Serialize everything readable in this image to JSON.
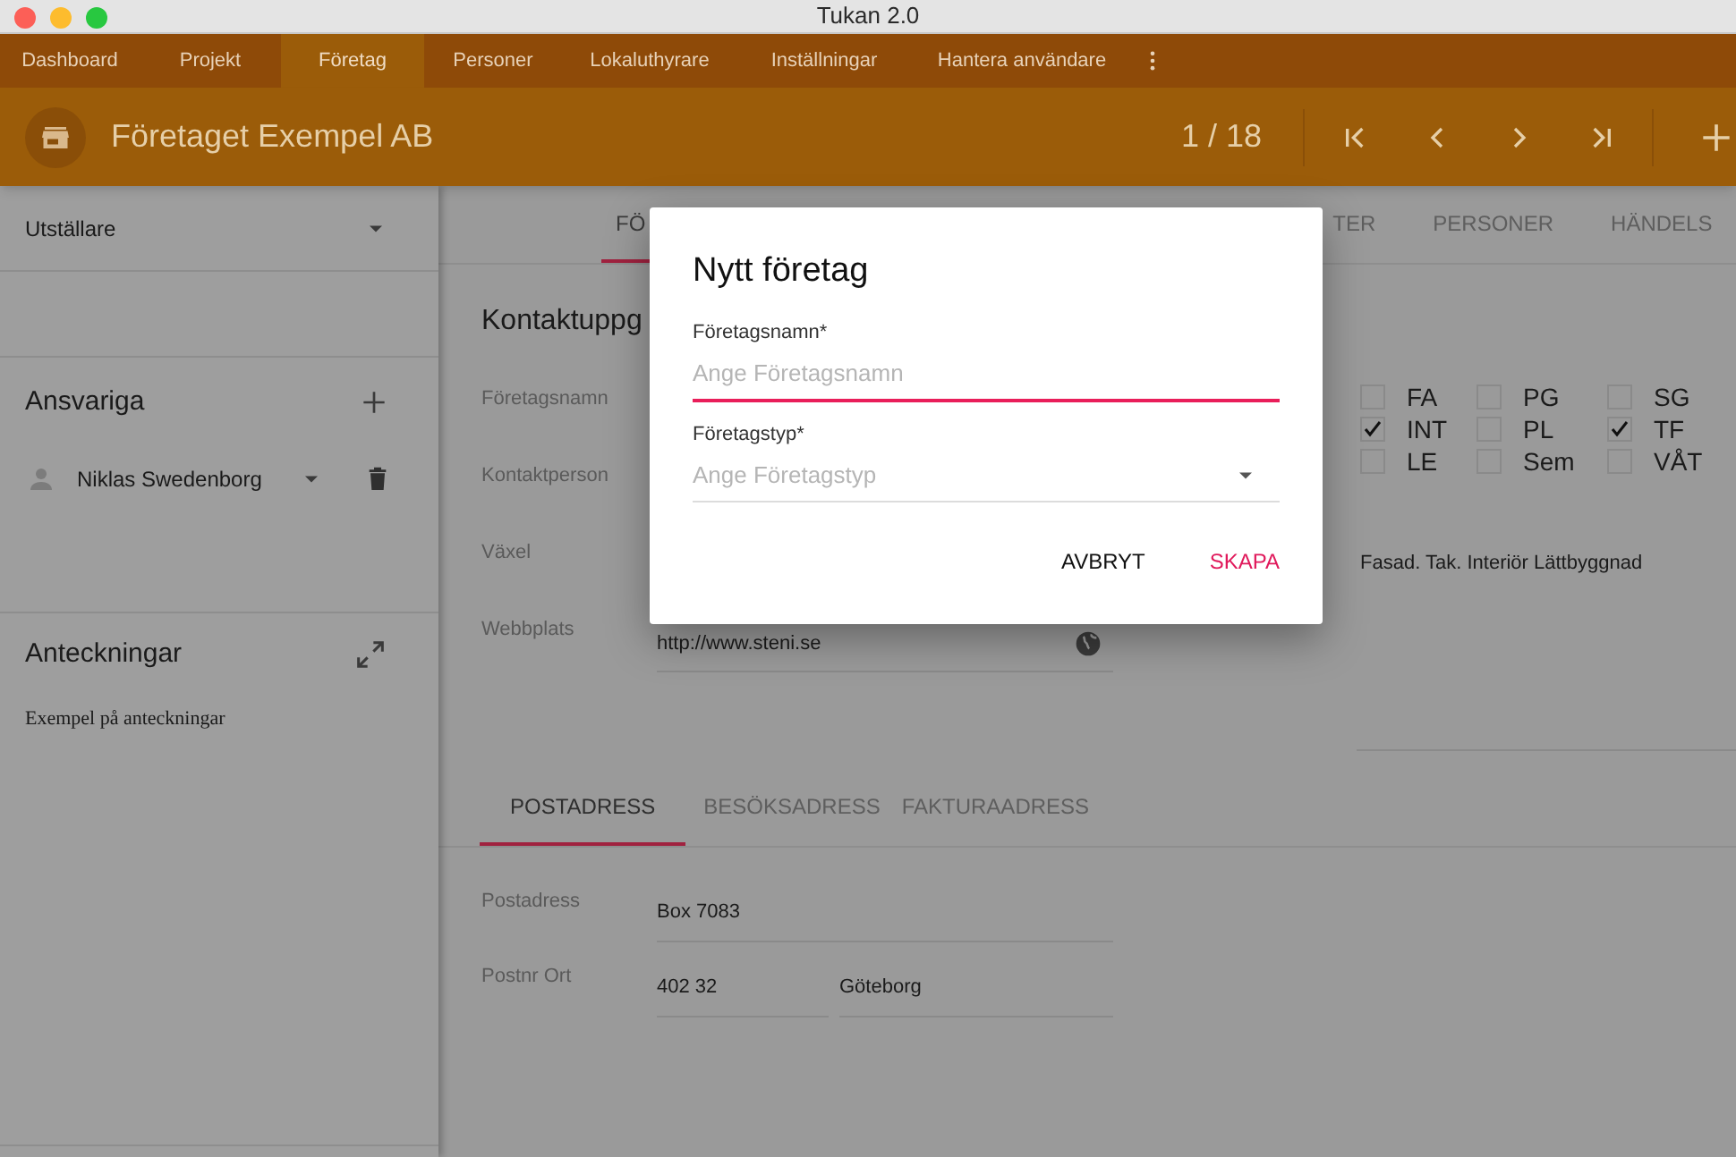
{
  "window": {
    "title": "Tukan 2.0"
  },
  "nav": {
    "items": [
      {
        "label": "Dashboard",
        "selected": false
      },
      {
        "label": "Projekt",
        "selected": false
      },
      {
        "label": "Företag",
        "selected": true
      },
      {
        "label": "Personer",
        "selected": false
      },
      {
        "label": "Lokaluthyrare",
        "selected": false
      },
      {
        "label": "Inställningar",
        "selected": false
      },
      {
        "label": "Hantera användare",
        "selected": false
      }
    ]
  },
  "header": {
    "title": "Företaget Exempel AB",
    "counter": "1 / 18"
  },
  "sidebar": {
    "dropdown": {
      "value": "Utställare"
    },
    "responsible": {
      "title": "Ansvariga",
      "people": [
        {
          "name": "Niklas Swedenborg"
        }
      ]
    },
    "notes": {
      "title": "Anteckningar",
      "text": "Exempel på anteckningar"
    }
  },
  "main": {
    "tabs": [
      {
        "label": "FÖ",
        "selected": true
      },
      {
        "label": "TER",
        "selected": false
      },
      {
        "label": "PERSONER",
        "selected": false
      },
      {
        "label": "HÄNDELS",
        "selected": false
      }
    ],
    "section_title": "Kontaktuppg",
    "fields": [
      {
        "label": "Företagsnamn"
      },
      {
        "label": "Kontaktperson"
      },
      {
        "label": "Växel"
      },
      {
        "label": "Webbplats",
        "value": "http://www.steni.se"
      }
    ],
    "tags": [
      {
        "label": "FA",
        "checked": false
      },
      {
        "label": "PG",
        "checked": false
      },
      {
        "label": "SG",
        "checked": false
      },
      {
        "label": "INT",
        "checked": true
      },
      {
        "label": "PL",
        "checked": false
      },
      {
        "label": "TF",
        "checked": true
      },
      {
        "label": "LE",
        "checked": false
      },
      {
        "label": "Sem",
        "checked": false
      },
      {
        "label": "VÅT",
        "checked": false
      }
    ],
    "tags_text": "Fasad. Tak. Interiör Lättbyggnad",
    "address_tabs": [
      {
        "label": "POSTADRESS",
        "selected": true
      },
      {
        "label": "BESÖKSADRESS",
        "selected": false
      },
      {
        "label": "FAKTURAADRESS",
        "selected": false
      }
    ],
    "address_fields": [
      {
        "label": "Postadress",
        "values": [
          "Box 7083"
        ]
      },
      {
        "label": "Postnr Ort",
        "values": [
          "402 32",
          "Göteborg"
        ]
      }
    ]
  },
  "dialog": {
    "title": "Nytt företag",
    "fields": [
      {
        "kind": "text",
        "label": "Företagsnamn*",
        "placeholder": "Ange Företagsnamn",
        "focused": true
      },
      {
        "kind": "select",
        "label": "Företagstyp*",
        "placeholder": "Ange Företagstyp",
        "focused": false
      }
    ],
    "buttons": [
      {
        "label": "AVBRYT",
        "kind": "secondary"
      },
      {
        "label": "SKAPA",
        "kind": "primary"
      }
    ]
  }
}
